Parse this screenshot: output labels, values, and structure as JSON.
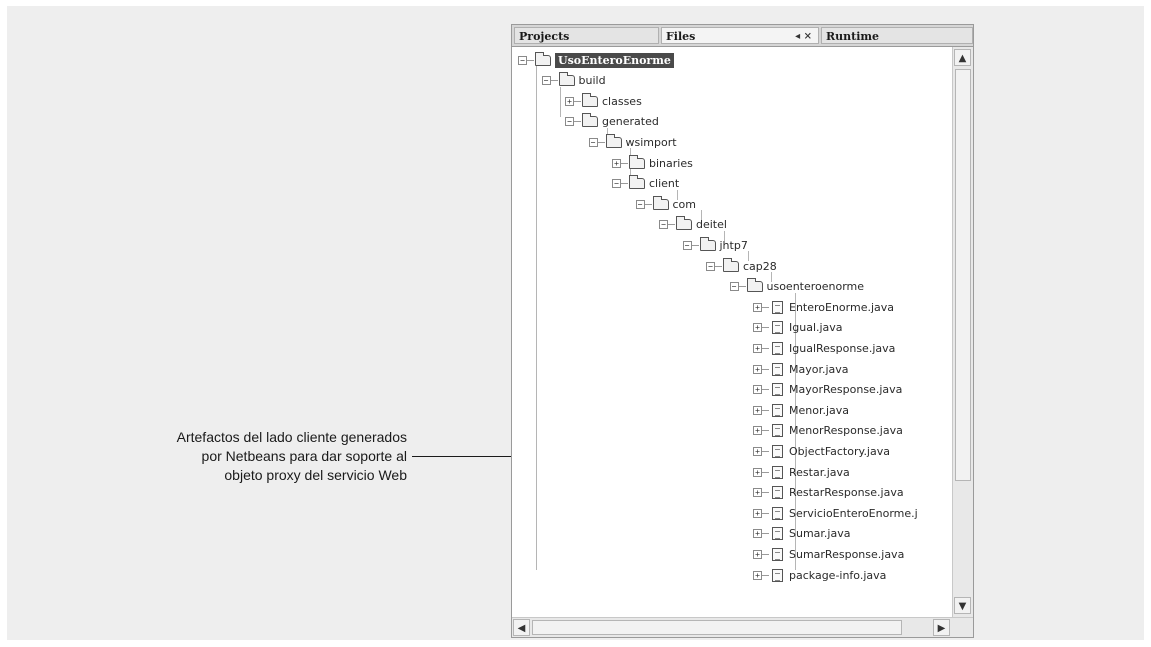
{
  "caption": {
    "lines": [
      "Artefactos del lado cliente generados",
      "por Netbeans para dar soporte al",
      "objeto proxy del servicio Web"
    ]
  },
  "tabs": [
    {
      "label": "Projects"
    },
    {
      "label": "Files",
      "controls": "◂ ×"
    },
    {
      "label": "Runtime"
    }
  ],
  "tree": [
    {
      "label": "UsoEnteroEnorme",
      "type": "folder",
      "expanded": true,
      "selected": true
    },
    {
      "label": "build",
      "type": "folder",
      "expanded": true
    },
    {
      "label": "classes",
      "type": "folder",
      "expanded": false
    },
    {
      "label": "generated",
      "type": "folder",
      "expanded": true
    },
    {
      "label": "wsimport",
      "type": "folder",
      "expanded": true
    },
    {
      "label": "binaries",
      "type": "folder",
      "expanded": false
    },
    {
      "label": "client",
      "type": "folder",
      "expanded": true
    },
    {
      "label": "com",
      "type": "folder",
      "expanded": true
    },
    {
      "label": "deitel",
      "type": "folder",
      "expanded": true
    },
    {
      "label": "jhtp7",
      "type": "folder",
      "expanded": true
    },
    {
      "label": "cap28",
      "type": "folder",
      "expanded": true
    },
    {
      "label": "usoenteroenorme",
      "type": "folder",
      "expanded": true
    },
    {
      "label": "EnteroEnorme.java",
      "type": "file"
    },
    {
      "label": "Igual.java",
      "type": "file"
    },
    {
      "label": "IgualResponse.java",
      "type": "file"
    },
    {
      "label": "Mayor.java",
      "type": "file"
    },
    {
      "label": "MayorResponse.java",
      "type": "file"
    },
    {
      "label": "Menor.java",
      "type": "file"
    },
    {
      "label": "MenorResponse.java",
      "type": "file"
    },
    {
      "label": "ObjectFactory.java",
      "type": "file"
    },
    {
      "label": "Restar.java",
      "type": "file"
    },
    {
      "label": "RestarResponse.java",
      "type": "file"
    },
    {
      "label": "ServicioEnteroEnorme.j",
      "type": "file"
    },
    {
      "label": "Sumar.java",
      "type": "file"
    },
    {
      "label": "SumarResponse.java",
      "type": "file"
    },
    {
      "label": "package-info.java",
      "type": "file"
    }
  ],
  "scroll": {
    "up": "▲",
    "down": "▼",
    "left": "◀",
    "right": "▶"
  }
}
